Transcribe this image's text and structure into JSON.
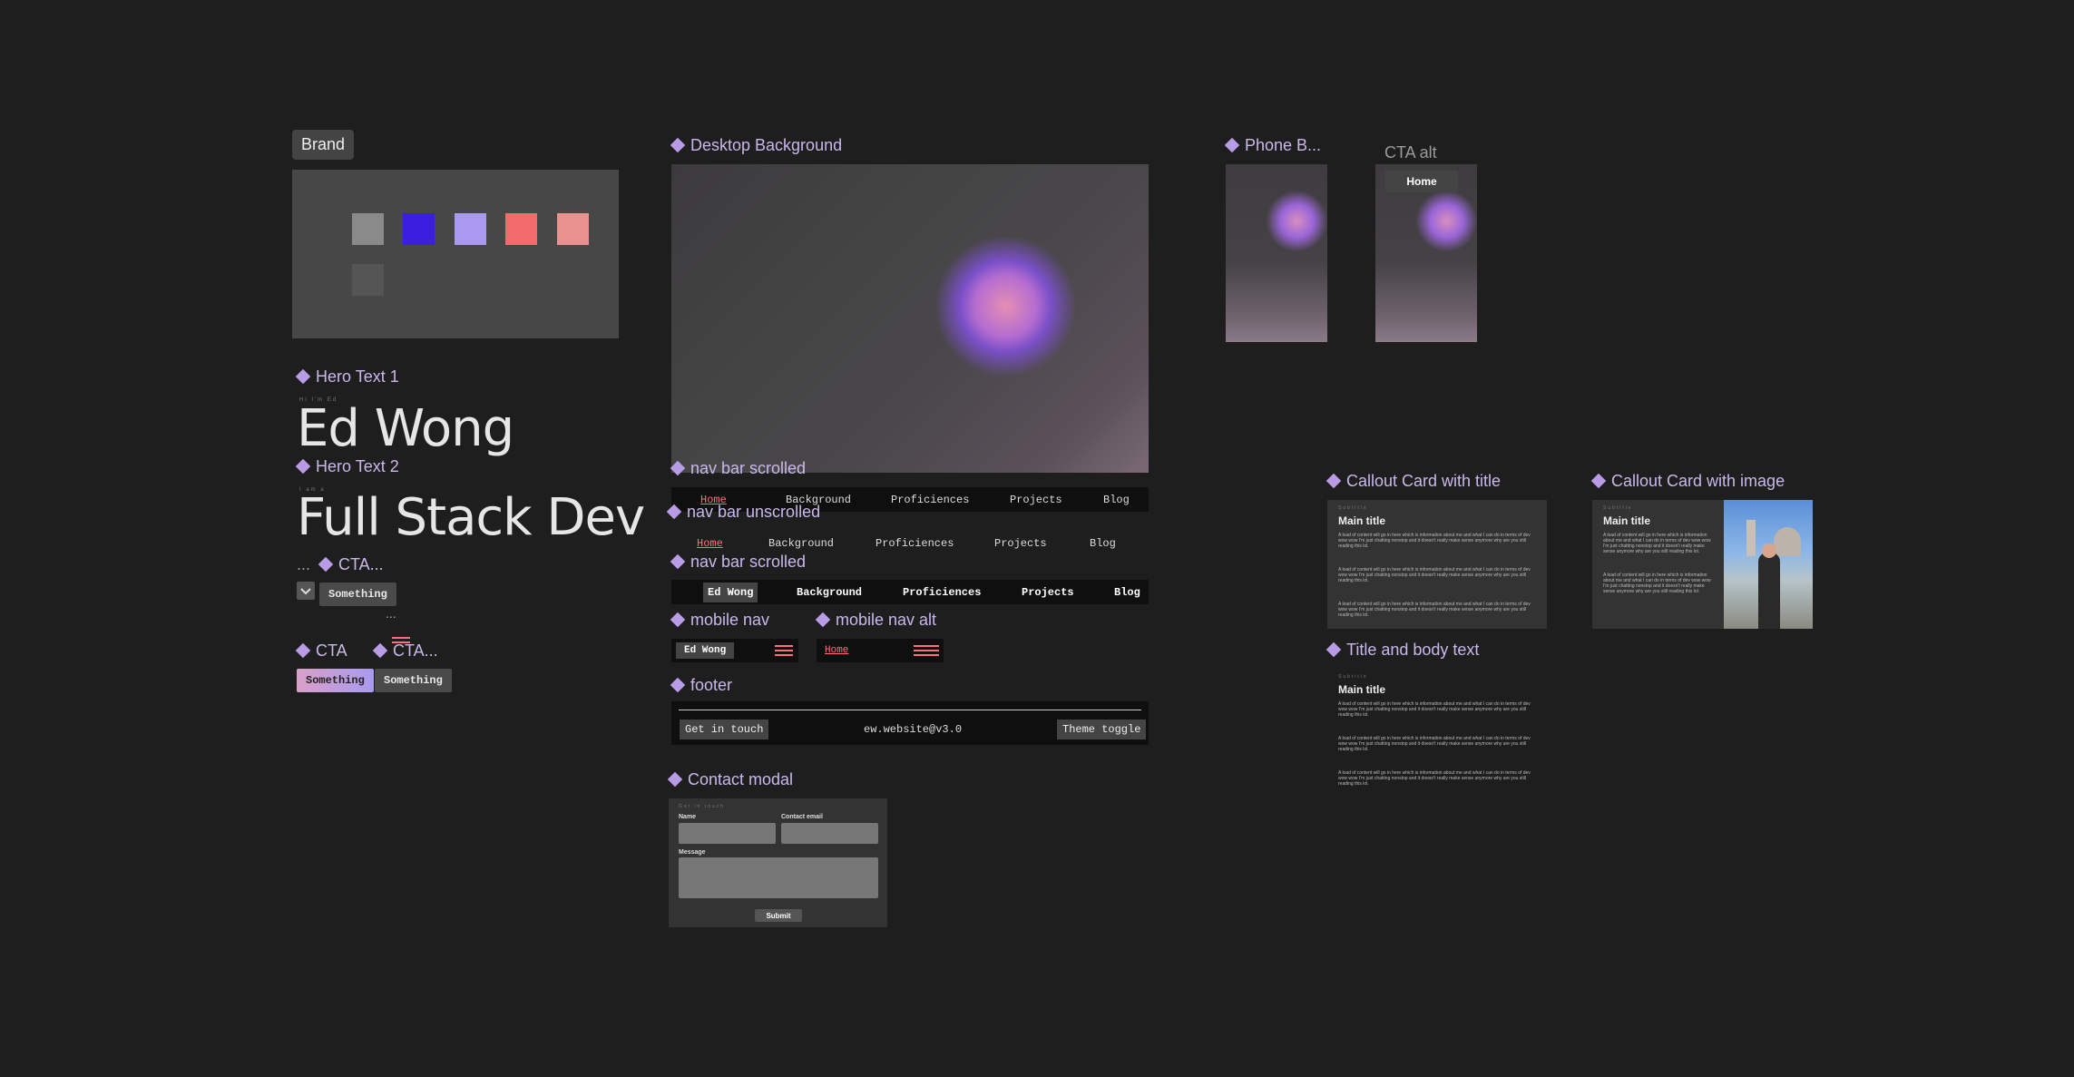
{
  "brand": {
    "label": "Brand",
    "swatches": [
      "#8a8a8a",
      "#3b1fe0",
      "#a99af0",
      "#f26b6b",
      "#e8918f",
      "#555555"
    ]
  },
  "frames": {
    "hero_text_1": "Hero Text 1",
    "hero_text_2": "Hero Text 2",
    "cta_label_a": "CTA...",
    "cta_label_b": "CTA",
    "cta_label_c": "CTA...",
    "desktop_background": "Desktop Background",
    "phone_background": "Phone B...",
    "cta_alt": "CTA alt",
    "nav_bar_scrolled_1": "nav bar scrolled",
    "nav_bar_unscrolled": "nav bar unscrolled",
    "nav_bar_scrolled_2": "nav bar scrolled",
    "mobile_nav": "mobile nav",
    "mobile_nav_alt": "mobile nav alt",
    "footer": "footer",
    "contact_modal": "Contact modal",
    "callout_card_title": "Callout Card with title",
    "callout_card_image": "Callout Card with image",
    "title_body_text": "Title and body text"
  },
  "hero": {
    "name": "Ed Wong",
    "role": "Full Stack Dev",
    "eyebrow_1": "Hi I'm Ed",
    "eyebrow_2": "I am a"
  },
  "cta": {
    "dropdown_text": "Something",
    "button_gradient": "Something",
    "button_grey": "Something",
    "ellipsis_1": "...",
    "ellipsis_2": "..."
  },
  "cta_alt_button": "Home",
  "nav": {
    "items": [
      "Home",
      "Background",
      "Proficiences",
      "Projects",
      "Blog"
    ],
    "brand": "Ed Wong"
  },
  "mobile_nav": {
    "brand": "Ed Wong",
    "alt_link": "Home"
  },
  "footer": {
    "left": "Get in touch",
    "center": "ew.website@v3.0",
    "right": "Theme toggle"
  },
  "modal": {
    "eyebrow": "Get in touch",
    "name_label": "Name",
    "email_label": "Contact email",
    "message_label": "Message",
    "submit": "Submit"
  },
  "cards": {
    "subtitle": "Subtitle",
    "main_title": "Main title",
    "body": "A load of content will go in here which is information about me and what I can do in terms of dev wow wow I'm just chatting nonstop and it doesn't really make sense anymore why are you still reading this lol."
  },
  "colors": {
    "canvas": "#1e1e1e",
    "accent_purple": "#c9b8ea",
    "accent_pink": "#ff6f7d"
  }
}
